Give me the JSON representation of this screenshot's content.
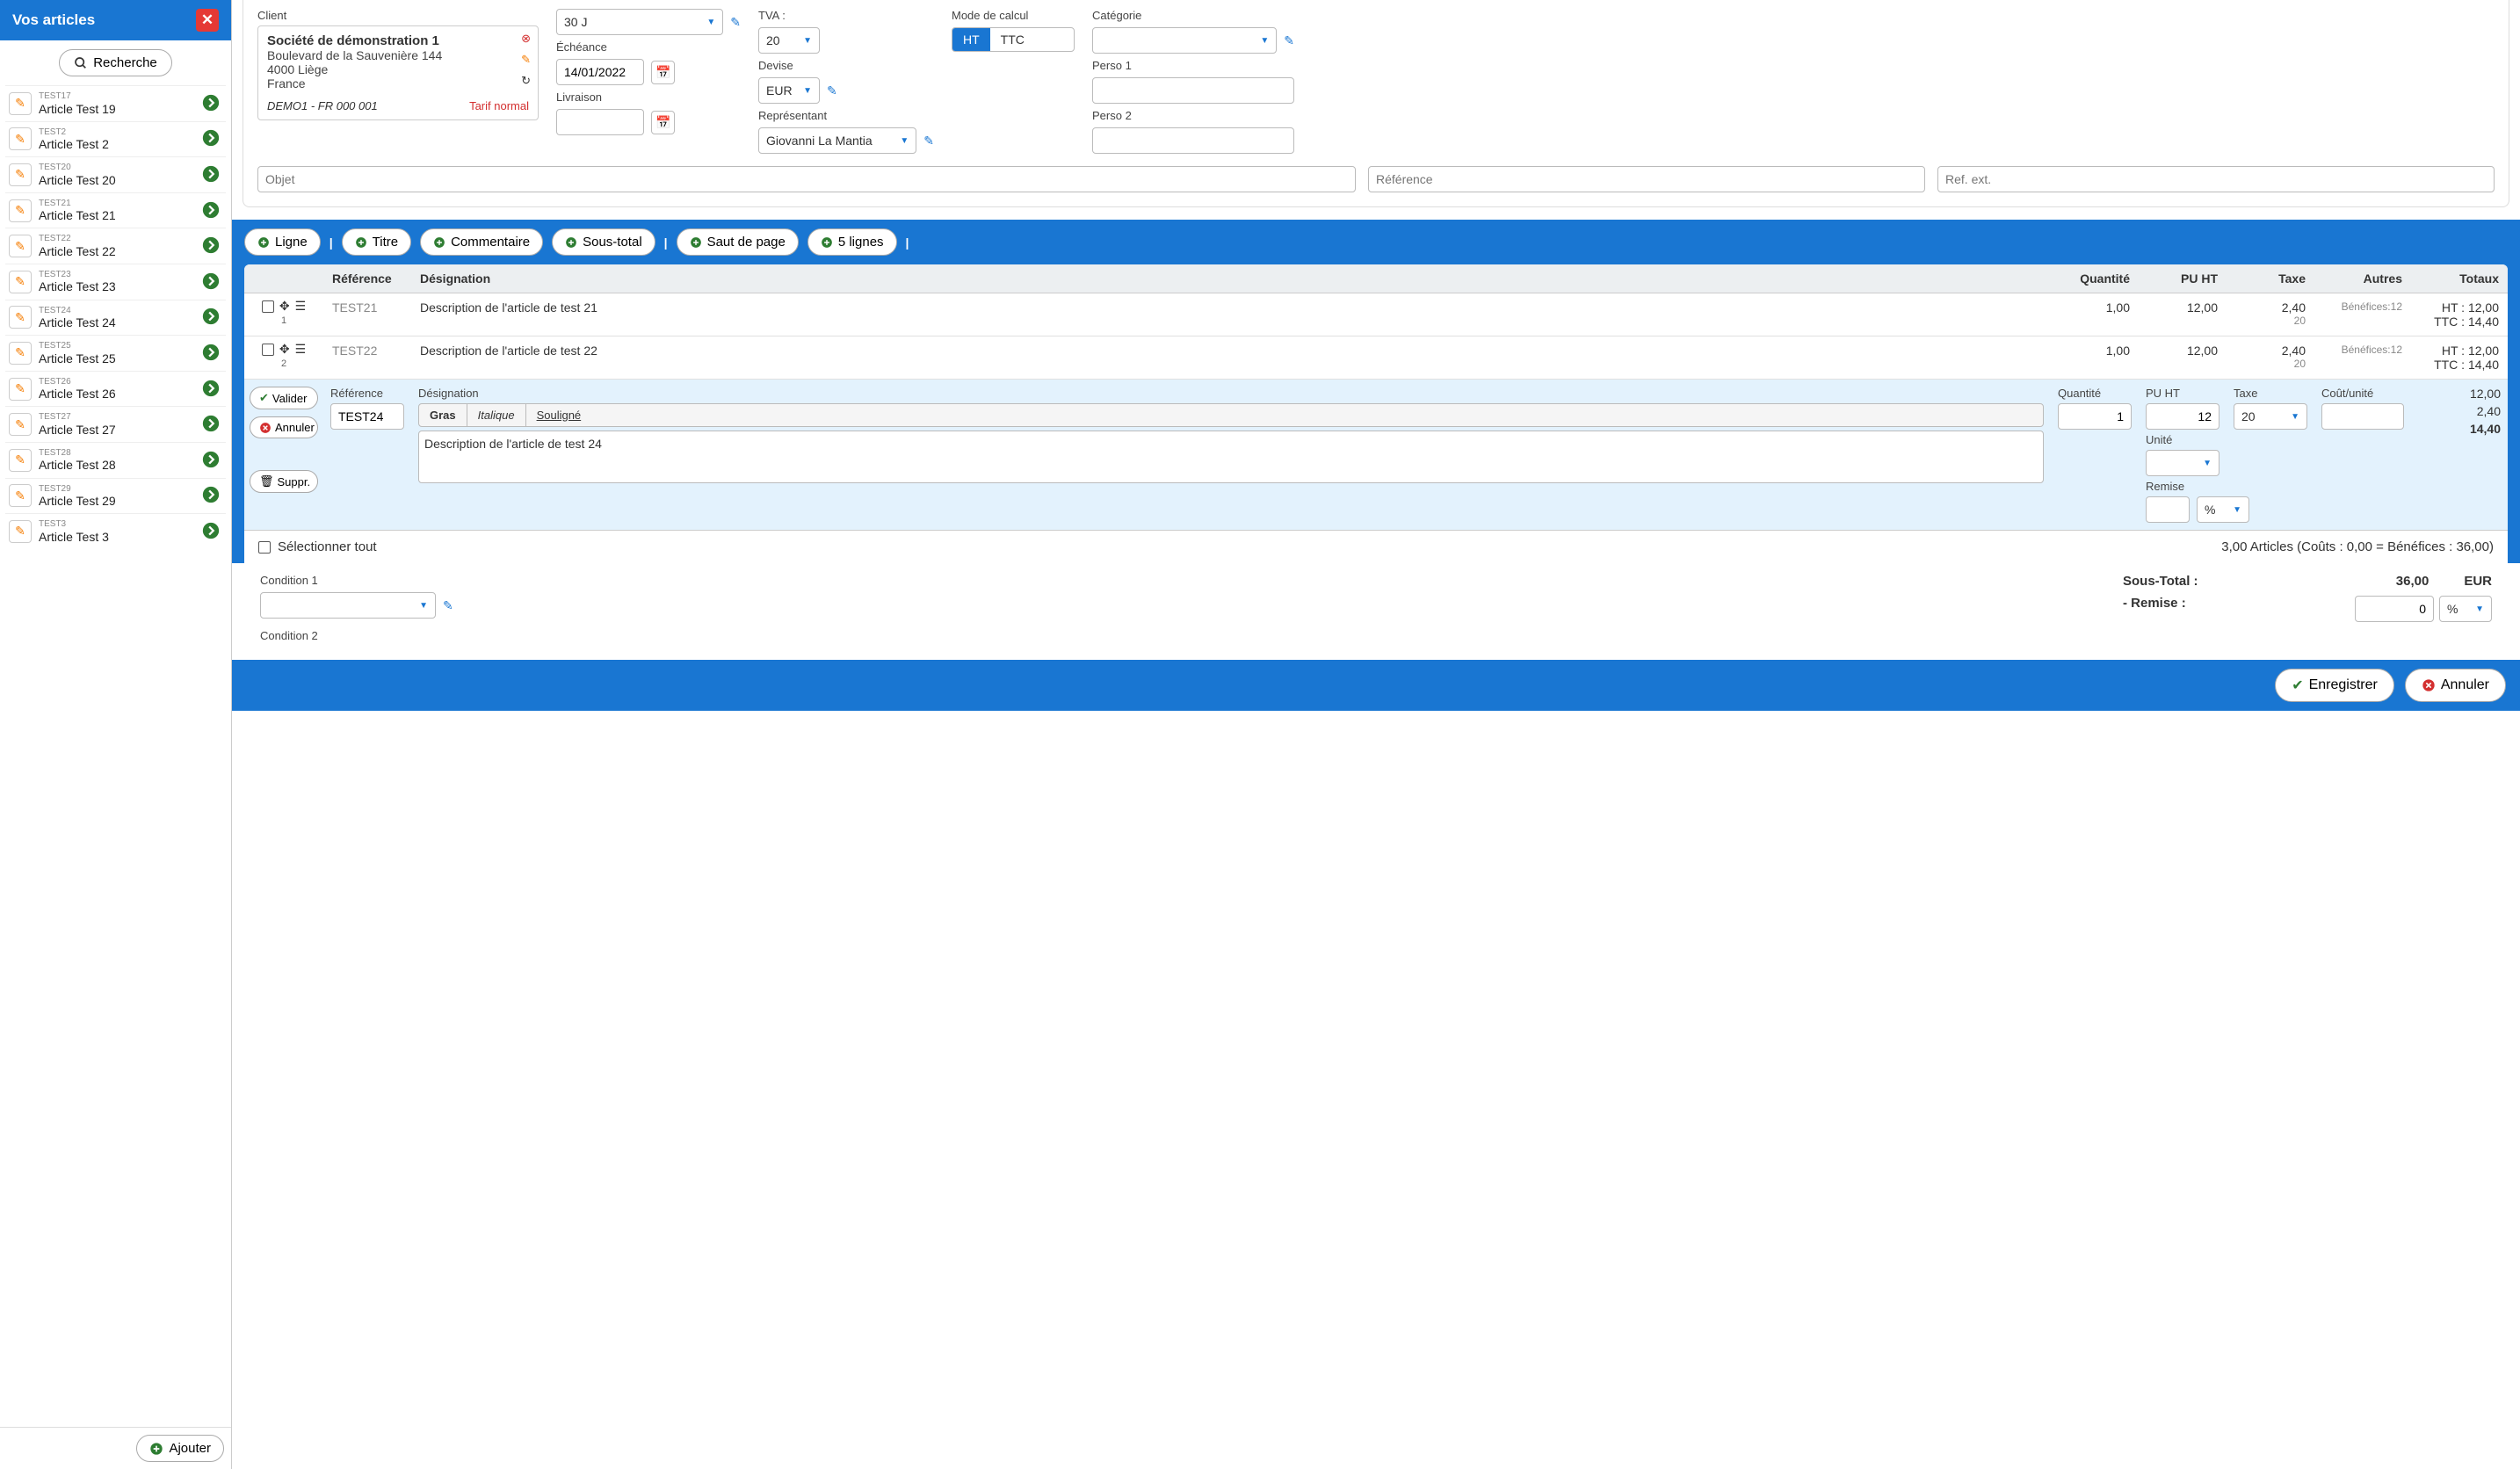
{
  "sidebar": {
    "title": "Vos articles",
    "search_label": "Recherche",
    "ajouter_label": "Ajouter",
    "items": [
      {
        "code": "TEST17",
        "name": "Article Test 19"
      },
      {
        "code": "TEST2",
        "name": "Article Test 2"
      },
      {
        "code": "TEST20",
        "name": "Article Test 20"
      },
      {
        "code": "TEST21",
        "name": "Article Test 21"
      },
      {
        "code": "TEST22",
        "name": "Article Test 22"
      },
      {
        "code": "TEST23",
        "name": "Article Test 23"
      },
      {
        "code": "TEST24",
        "name": "Article Test 24"
      },
      {
        "code": "TEST25",
        "name": "Article Test 25"
      },
      {
        "code": "TEST26",
        "name": "Article Test 26"
      },
      {
        "code": "TEST27",
        "name": "Article Test 27"
      },
      {
        "code": "TEST28",
        "name": "Article Test 28"
      },
      {
        "code": "TEST29",
        "name": "Article Test 29"
      },
      {
        "code": "TEST3",
        "name": "Article Test 3"
      }
    ]
  },
  "client": {
    "label": "Client",
    "name": "Société de démonstration 1",
    "addr1": "Boulevard de la Sauvenière 144",
    "addr2": "4000 Liège",
    "addr3": "France",
    "code": "DEMO1 - FR 000 001",
    "tarif": "Tarif normal"
  },
  "fields": {
    "terms_value": "30 J",
    "echeance_label": "Échéance",
    "echeance_value": "14/01/2022",
    "livraison_label": "Livraison",
    "tva_label": "TVA :",
    "tva_value": "20",
    "devise_label": "Devise",
    "devise_value": "EUR",
    "representant_label": "Représentant",
    "representant_value": "Giovanni La Mantia",
    "mode_label": "Mode de calcul",
    "mode_ht": "HT",
    "mode_ttc": "TTC",
    "categorie_label": "Catégorie",
    "perso1_label": "Perso 1",
    "perso2_label": "Perso 2"
  },
  "refs": {
    "objet_ph": "Objet",
    "reference_ph": "Référence",
    "refext_ph": "Ref. ext."
  },
  "linebtns": {
    "ligne": "Ligne",
    "titre": "Titre",
    "commentaire": "Commentaire",
    "soustotal": "Sous-total",
    "saut": "Saut de page",
    "cinq": "5 lignes"
  },
  "columns": {
    "ref": "Référence",
    "desig": "Désignation",
    "qty": "Quantité",
    "pu": "PU HT",
    "tax": "Taxe",
    "autres": "Autres",
    "totaux": "Totaux"
  },
  "rows": [
    {
      "num": "1",
      "ref": "TEST21",
      "desig": "Description de l'article de test 21",
      "qty": "1,00",
      "pu": "12,00",
      "tax": "2,40",
      "taxrate": "20",
      "benef": "Bénéfices:12",
      "ht": "HT : 12,00",
      "ttc": "TTC : 14,40"
    },
    {
      "num": "2",
      "ref": "TEST22",
      "desig": "Description de l'article de test 22",
      "qty": "1,00",
      "pu": "12,00",
      "tax": "2,40",
      "taxrate": "20",
      "benef": "Bénéfices:12",
      "ht": "HT : 12,00",
      "ttc": "TTC : 14,40"
    }
  ],
  "edit": {
    "valider": "Valider",
    "annuler": "Annuler",
    "suppr": "Suppr.",
    "ref_label": "Référence",
    "ref_value": "TEST24",
    "desig_label": "Désignation",
    "desig_value": "Description de l'article de test 24",
    "gras": "Gras",
    "italique": "Italique",
    "souligne": "Souligné",
    "qty_label": "Quantité",
    "qty_value": "1",
    "pu_label": "PU HT",
    "pu_value": "12",
    "unite_label": "Unité",
    "remise_label": "Remise",
    "remise_unit": "%",
    "tax_label": "Taxe",
    "tax_value": "20",
    "cost_label": "Coût/unité",
    "tot1": "12,00",
    "tot2": "2,40",
    "tot3": "14,40"
  },
  "summary": {
    "select_all": "Sélectionner tout",
    "line": "3,00 Articles (Coûts : 0,00 = Bénéfices : 36,00)"
  },
  "conditions": {
    "cond1_label": "Condition 1",
    "cond2_label": "Condition 2",
    "sous_total_label": "Sous-Total :",
    "sous_total_value": "36,00",
    "sous_total_cur": "EUR",
    "remise_label": "- Remise :",
    "remise_value": "0",
    "remise_unit": "%"
  },
  "footer": {
    "enregistrer": "Enregistrer",
    "annuler": "Annuler"
  }
}
